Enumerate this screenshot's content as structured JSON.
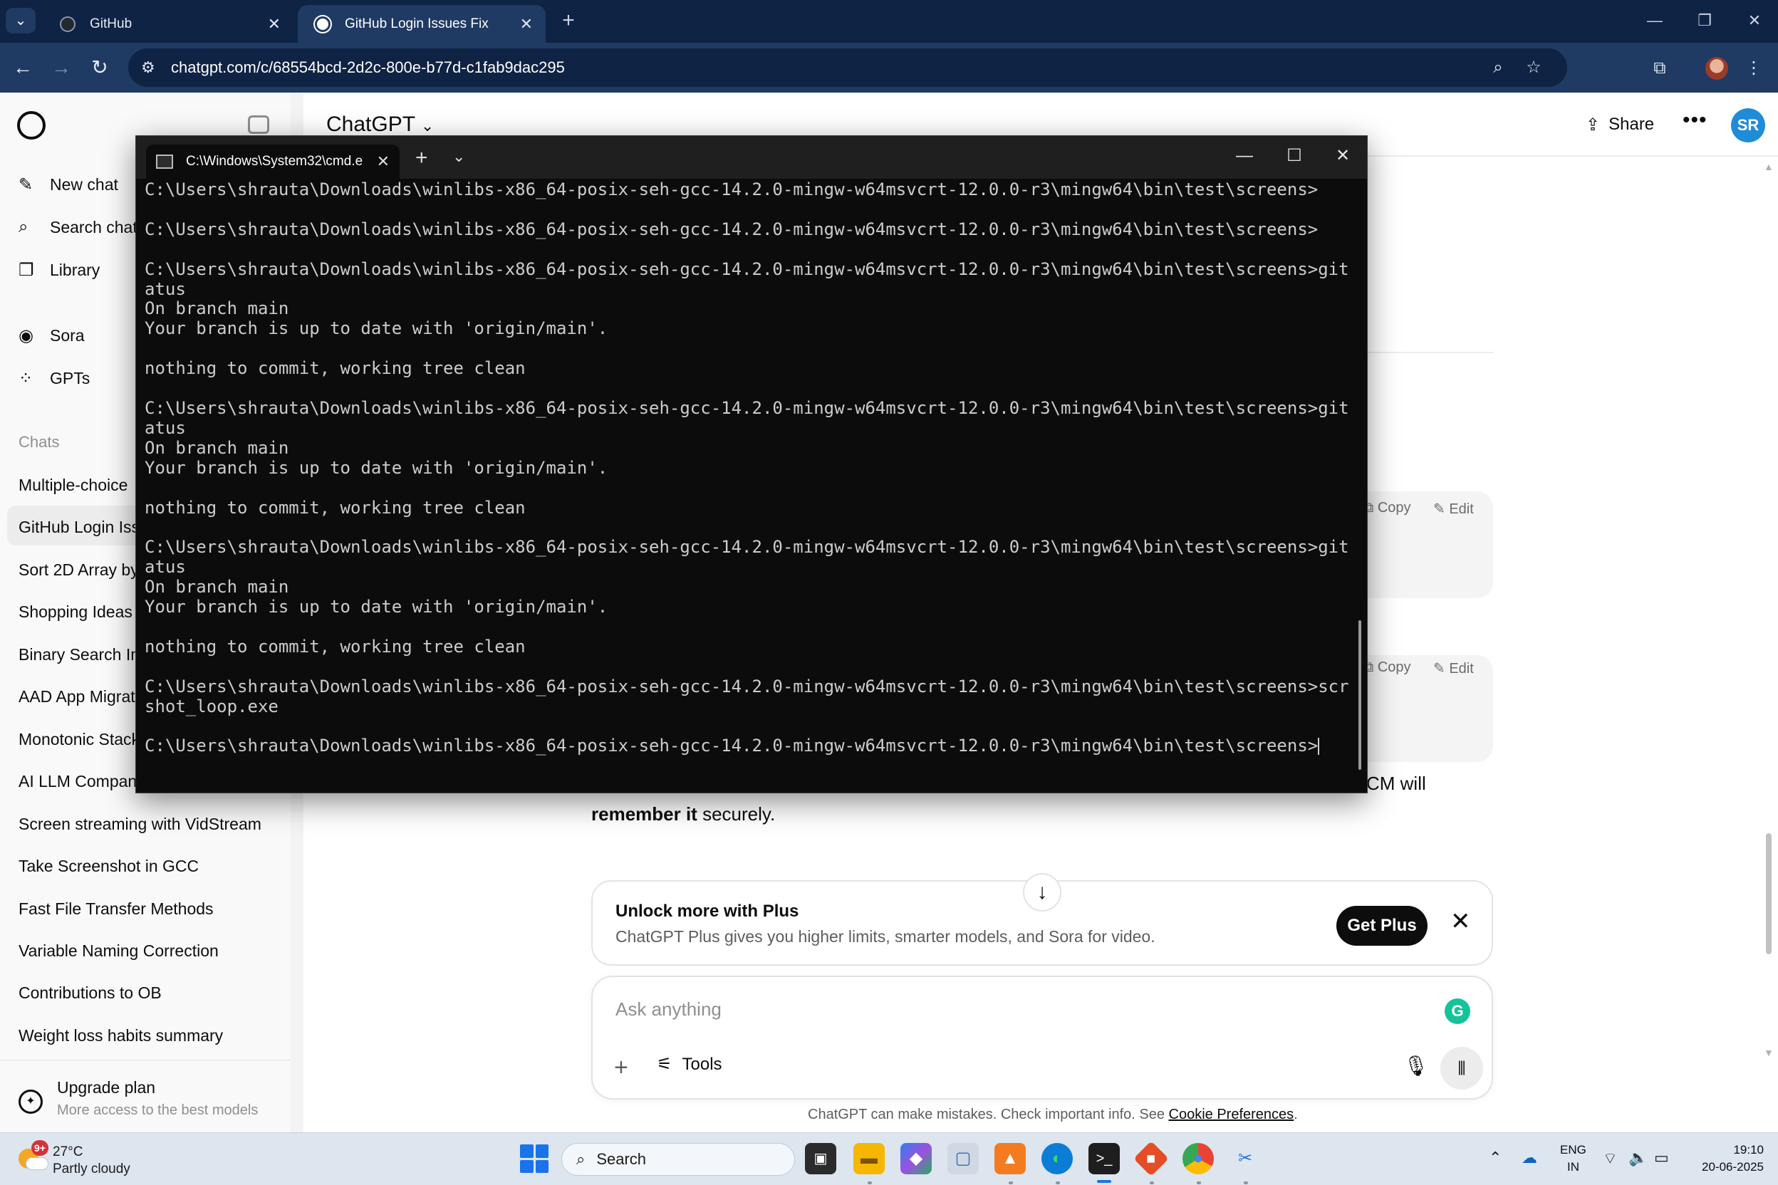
{
  "browser": {
    "tabs": [
      {
        "title": "GitHub",
        "active": false
      },
      {
        "title": "GitHub Login Issues Fix",
        "active": true
      }
    ],
    "url": "chatgpt.com/c/68554bcd-2d2c-800e-b77d-c1fab9dac295"
  },
  "sidebar": {
    "nav": [
      {
        "label": "New chat",
        "icon": "edit-icon"
      },
      {
        "label": "Search chats",
        "icon": "search-icon"
      },
      {
        "label": "Library",
        "icon": "library-icon"
      },
      {
        "label": "Sora",
        "icon": "play-icon"
      },
      {
        "label": "GPTs",
        "icon": "grid-icon"
      }
    ],
    "section_label": "Chats",
    "chats": [
      "Multiple-choice",
      "GitHub Login Iss",
      "Sort 2D Array by",
      "Shopping Ideas",
      "Binary Search Im",
      "AAD App Migrat",
      "Monotonic Stack",
      "AI LLM Compan",
      "Screen streaming with VidStream",
      "Take Screenshot in GCC",
      "Fast File Transfer Methods",
      "Variable Naming Correction",
      "Contributions to OB",
      "Weight loss habits summary"
    ],
    "active_chat_index": 1,
    "upgrade": {
      "title": "Upgrade plan",
      "subtitle": "More access to the best models"
    }
  },
  "chat": {
    "title": "ChatGPT",
    "share_label": "Share",
    "avatar_initials": "SR",
    "actions": {
      "copy": "Copy",
      "edit": "Edit"
    },
    "answer_fragment": "CM will",
    "answer_bold": "remember it",
    "answer_rest": " securely.",
    "promo": {
      "title": "Unlock more with Plus",
      "subtitle": "ChatGPT Plus gives you higher limits, smarter models, and Sora for video.",
      "button": "Get Plus"
    },
    "composer_placeholder": "Ask anything",
    "tools_label": "Tools",
    "disclaimer_text": "ChatGPT can make mistakes. Check important info. See ",
    "disclaimer_link": "Cookie Preferences",
    "disclaimer_end": "."
  },
  "terminal": {
    "tab_title": "C:\\Windows\\System32\\cmd.e",
    "lines": [
      "C:\\Users\\shrauta\\Downloads\\winlibs-x86_64-posix-seh-gcc-14.2.0-mingw-w64msvcrt-12.0.0-r3\\mingw64\\bin\\test\\screens>",
      "",
      "C:\\Users\\shrauta\\Downloads\\winlibs-x86_64-posix-seh-gcc-14.2.0-mingw-w64msvcrt-12.0.0-r3\\mingw64\\bin\\test\\screens>",
      "",
      "C:\\Users\\shrauta\\Downloads\\winlibs-x86_64-posix-seh-gcc-14.2.0-mingw-w64msvcrt-12.0.0-r3\\mingw64\\bin\\test\\screens>git st",
      "atus",
      "On branch main",
      "Your branch is up to date with 'origin/main'.",
      "",
      "nothing to commit, working tree clean",
      "",
      "C:\\Users\\shrauta\\Downloads\\winlibs-x86_64-posix-seh-gcc-14.2.0-mingw-w64msvcrt-12.0.0-r3\\mingw64\\bin\\test\\screens>git st",
      "atus",
      "On branch main",
      "Your branch is up to date with 'origin/main'.",
      "",
      "nothing to commit, working tree clean",
      "",
      "C:\\Users\\shrauta\\Downloads\\winlibs-x86_64-posix-seh-gcc-14.2.0-mingw-w64msvcrt-12.0.0-r3\\mingw64\\bin\\test\\screens>git st",
      "atus",
      "On branch main",
      "Your branch is up to date with 'origin/main'.",
      "",
      "nothing to commit, working tree clean",
      "",
      "C:\\Users\\shrauta\\Downloads\\winlibs-x86_64-posix-seh-gcc-14.2.0-mingw-w64msvcrt-12.0.0-r3\\mingw64\\bin\\test\\screens>screen",
      "shot_loop.exe",
      "",
      "C:\\Users\\shrauta\\Downloads\\winlibs-x86_64-posix-seh-gcc-14.2.0-mingw-w64msvcrt-12.0.0-r3\\mingw64\\bin\\test\\screens>"
    ]
  },
  "taskbar": {
    "weather": {
      "badge": "9+",
      "temp": "27°C",
      "condition": "Partly cloudy"
    },
    "search_label": "Search",
    "lang_line1": "ENG",
    "lang_line2": "IN",
    "time": "19:10",
    "date": "20-06-2025"
  }
}
